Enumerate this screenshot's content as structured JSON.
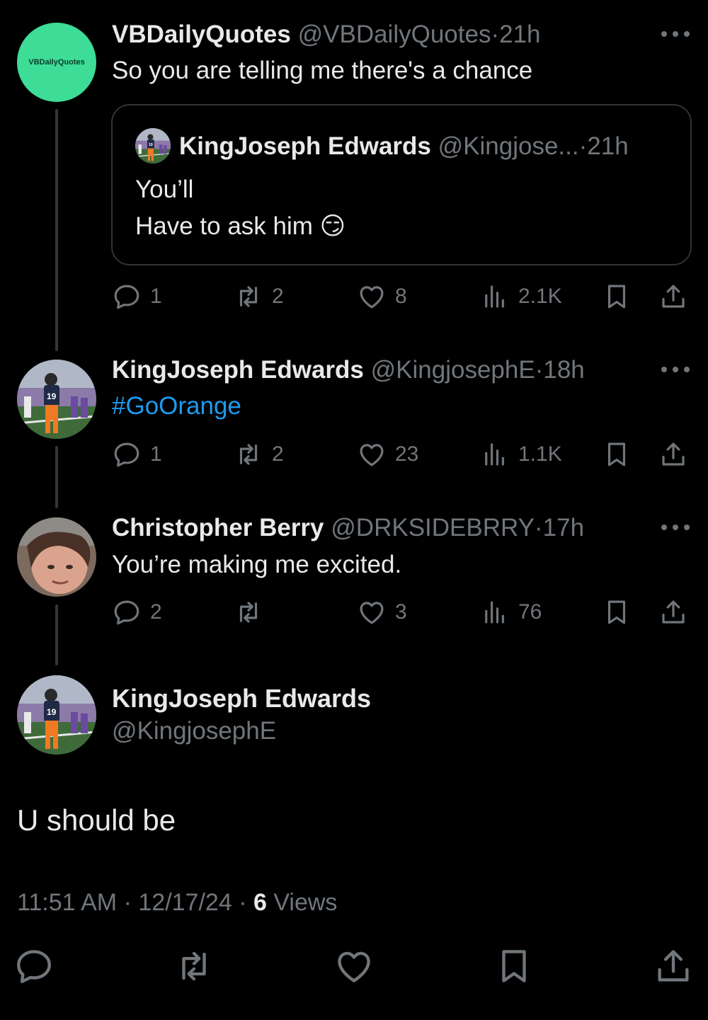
{
  "tweets": [
    {
      "name": "VBDailyQuotes",
      "handle": "@VBDailyQuotes",
      "sep": "·",
      "time": "21h",
      "text": "So you are telling me there's a chance",
      "avatar_label": "VBDailyQuotes",
      "avatar_color": "#3ddc97",
      "quote": {
        "name": "KingJoseph Edwards",
        "handle": "@Kingjose...",
        "sep": "·",
        "time": "21h",
        "line1": "You’ll",
        "line2": "Have to ask him",
        "emoji": "😏"
      },
      "stats": {
        "replies": "1",
        "reposts": "2",
        "likes": "8",
        "views": "2.1K"
      }
    },
    {
      "name": "KingJoseph Edwards",
      "handle": "@KingjosephE",
      "sep": "·",
      "time": "18h",
      "text": "#GoOrange",
      "stats": {
        "replies": "1",
        "reposts": "2",
        "likes": "23",
        "views": "1.1K"
      }
    },
    {
      "name": "Christopher Berry",
      "handle": "@DRKSIDEBRRY",
      "sep": "·",
      "time": "17h",
      "text": "You’re making me excited.",
      "stats": {
        "replies": "2",
        "reposts": "",
        "likes": "3",
        "views": "76"
      }
    }
  ],
  "focused": {
    "name": "KingJoseph Edwards",
    "handle": "@KingjosephE",
    "text": "U should be",
    "time": "11:51 AM",
    "sep1": "·",
    "date": "12/17/24",
    "sep2": "·",
    "views_count": "6",
    "views_label": "Views"
  },
  "colors": {
    "background": "#000000",
    "text": "#e7e9ea",
    "muted": "#71767b",
    "link": "#1d9bf0",
    "border": "#2f3336"
  },
  "icons": [
    "reply-icon",
    "repost-icon",
    "like-icon",
    "views-icon",
    "bookmark-icon",
    "share-icon",
    "more-icon"
  ]
}
